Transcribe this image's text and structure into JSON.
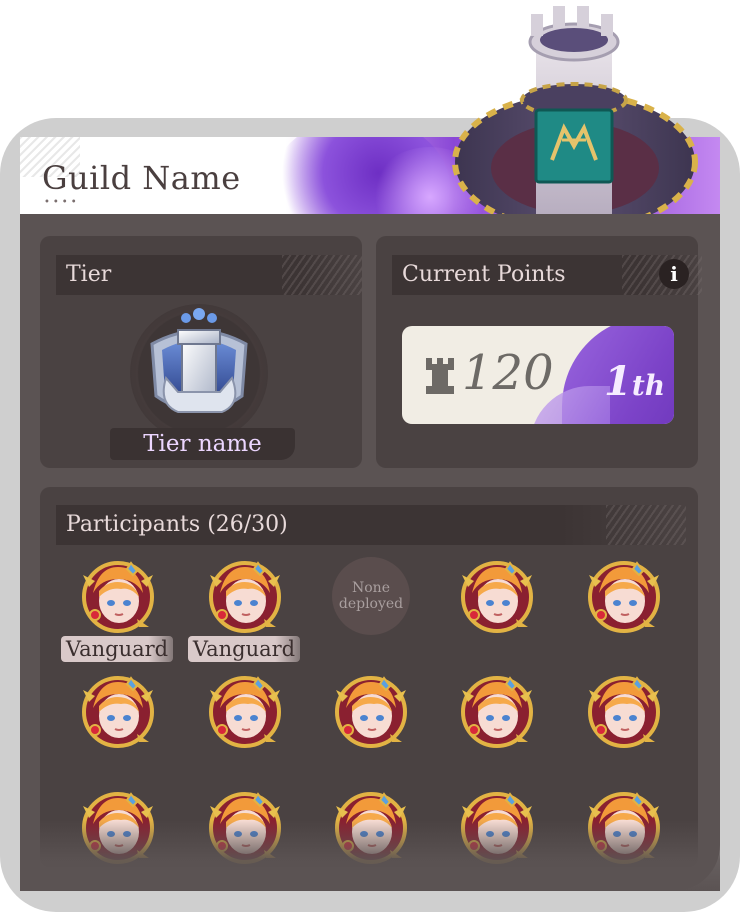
{
  "header": {
    "guild_name": "Guild Name",
    "dots": "••••"
  },
  "tier": {
    "title": "Tier",
    "tier_name": "Tier name"
  },
  "points": {
    "title": "Current Points",
    "value": "120",
    "rank_number": "1",
    "rank_suffix": "th",
    "info": "i"
  },
  "participants": {
    "title": "Participants",
    "count": "(26/30)",
    "vanguard_label": "Vanguard",
    "none_deployed_line1": "None",
    "none_deployed_line2": "deployed"
  },
  "colors": {
    "accent_purple": "#8a48d6",
    "panel_bg": "#4a4242",
    "frame_bg": "#5b5353"
  }
}
